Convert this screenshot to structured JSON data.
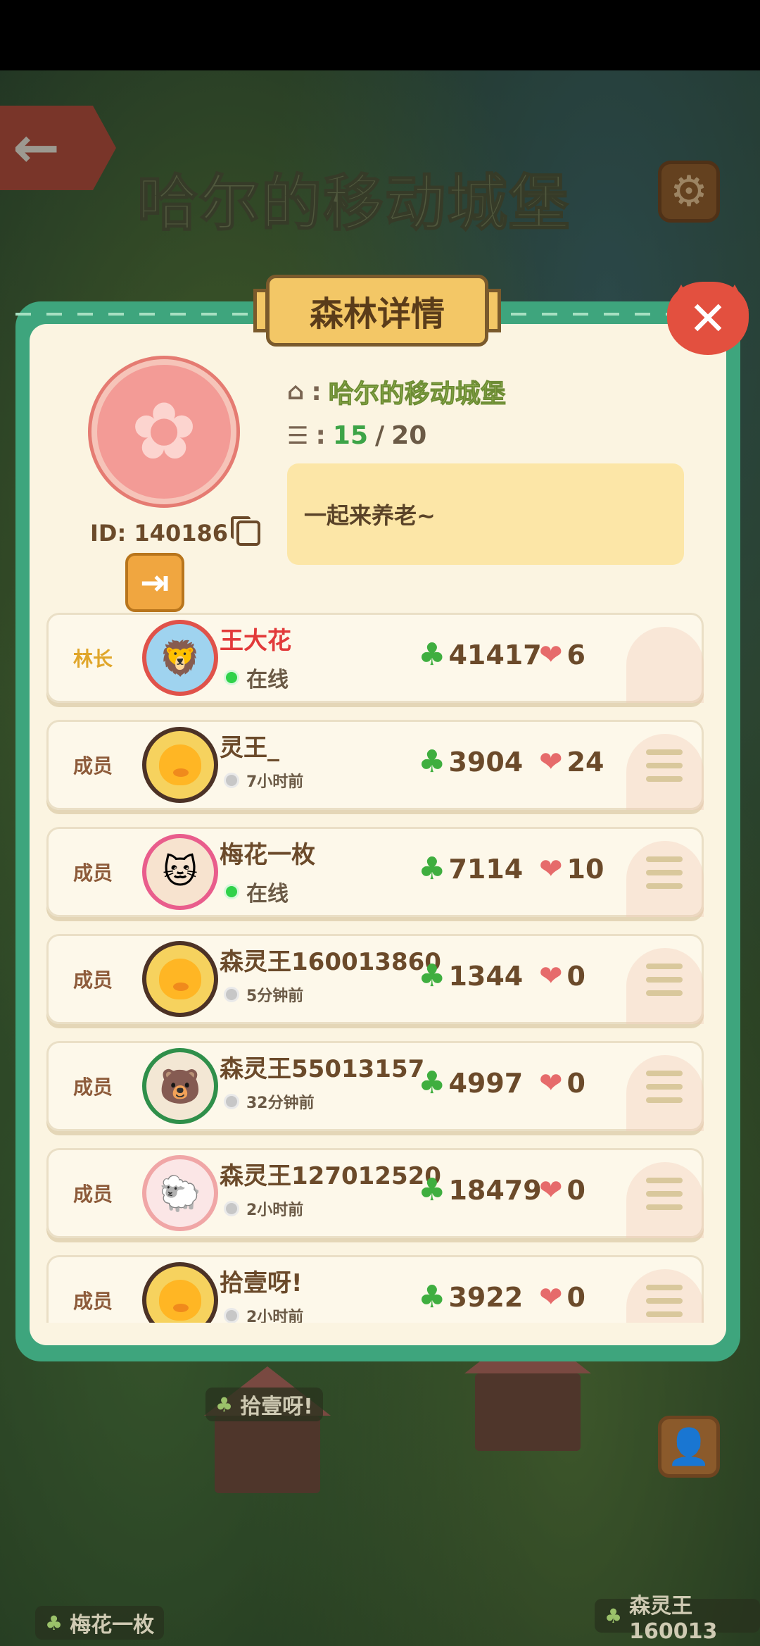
{
  "header": {
    "title": "哈尔的移动城堡"
  },
  "panel": {
    "title": "森林详情",
    "forest": {
      "id_label": "ID: 140186",
      "name": "哈尔的移动城堡",
      "member_count": "15",
      "member_sep": " / ",
      "member_max": "20",
      "motto": "一起来养老~"
    },
    "members": [
      {
        "role": "林长",
        "name": "王大花",
        "status": "在线",
        "online": true,
        "score": "41417",
        "likes": "6",
        "avatar": "lion"
      },
      {
        "role": "成员",
        "name": "灵王_",
        "status": "7小时前",
        "online": false,
        "score": "3904",
        "likes": "24",
        "avatar": "duck-rainbow"
      },
      {
        "role": "成员",
        "name": "梅花一枚",
        "status": "在线",
        "online": true,
        "score": "7114",
        "likes": "10",
        "avatar": "cat"
      },
      {
        "role": "成员",
        "name": "森灵王160013860",
        "status": "5分钟前",
        "online": false,
        "score": "1344",
        "likes": "0",
        "avatar": "duck"
      },
      {
        "role": "成员",
        "name": "森灵王55013157",
        "status": "32分钟前",
        "online": false,
        "score": "4997",
        "likes": "0",
        "avatar": "bear"
      },
      {
        "role": "成员",
        "name": "森灵王127012520",
        "status": "2小时前",
        "online": false,
        "score": "18479",
        "likes": "0",
        "avatar": "sheep"
      },
      {
        "role": "成员",
        "name": "拾壹呀!",
        "status": "2小时前",
        "online": false,
        "score": "3922",
        "likes": "0",
        "avatar": "duck-rainbow"
      }
    ]
  },
  "scene_labels": [
    {
      "text": "拾壹呀!"
    },
    {
      "text": "梅花一枚"
    },
    {
      "text": "森灵王160013"
    }
  ],
  "icons": {
    "back": "arrow-left-icon",
    "settings": "gear-icon",
    "close": "close-icon",
    "home": "home-icon",
    "members": "members-icon",
    "copy": "copy-icon",
    "exit": "exit-icon",
    "clover": "clover-icon",
    "like": "heart-icon",
    "menu": "menu-icon",
    "profile": "profile-icon"
  },
  "colors": {
    "panel_border": "#3ea57d",
    "panel_bg": "#fbf4e1",
    "tab_bg": "#f3c766",
    "close_red": "#e3503f",
    "online_green": "#2fd24a",
    "leader_gold": "#e0a62a",
    "name_red": "#e23a3a"
  }
}
